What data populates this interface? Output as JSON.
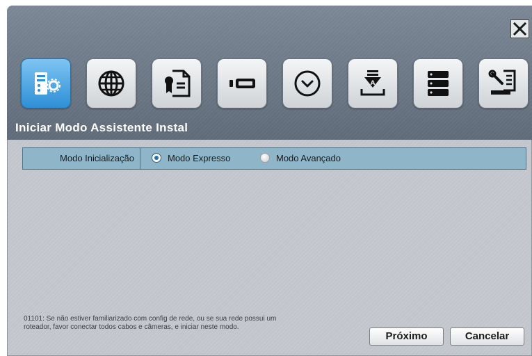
{
  "header": {
    "title": "Iniciar Modo Assistente Instal",
    "close_icon": "close-icon"
  },
  "toolbar": {
    "icons": [
      {
        "name": "startup-mode-icon",
        "active": true
      },
      {
        "name": "network-icon",
        "active": false
      },
      {
        "name": "certificate-document-icon",
        "active": false
      },
      {
        "name": "storage-device-icon",
        "active": false
      },
      {
        "name": "clock-icon",
        "active": false
      },
      {
        "name": "install-download-icon",
        "active": false
      },
      {
        "name": "server-rack-icon",
        "active": false
      },
      {
        "name": "tools-settings-icon",
        "active": false
      }
    ]
  },
  "form": {
    "row_label": "Modo Inicialização",
    "options": [
      {
        "label": "Modo Expresso",
        "selected": true
      },
      {
        "label": "Modo Avançado",
        "selected": false
      }
    ]
  },
  "footer": {
    "hint": "01101: Se não estiver familiarizado com config de rede, ou se sua rede possui um roteador, favor conectar todos cabos e câmeras, e iniciar neste modo.",
    "next_label": "Próximo",
    "cancel_label": "Cancelar"
  },
  "colors": {
    "header_bg": "#687482",
    "active_tile": "#2d8fd6",
    "row_bg": "#8fb5c8"
  }
}
